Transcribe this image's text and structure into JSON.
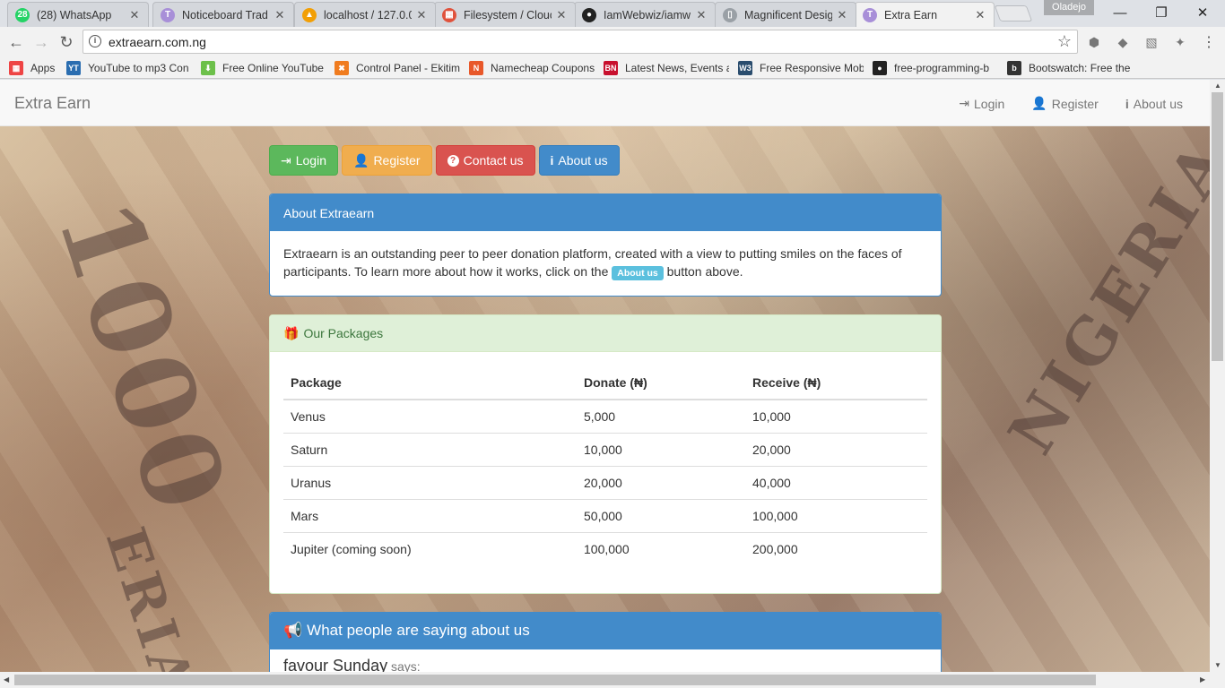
{
  "browser": {
    "tabs": [
      {
        "title": "(28) WhatsApp",
        "favicon": "whatsapp-icon",
        "color": "#25d366",
        "glyph": "28",
        "active": false
      },
      {
        "title": "Noticeboard Trad",
        "favicon": "t-letter-icon",
        "color": "#a88fd8",
        "glyph": "T",
        "active": false
      },
      {
        "title": "localhost / 127.0.0",
        "favicon": "phpmyadmin-icon",
        "color": "#f29f05",
        "glyph": "▲",
        "active": false
      },
      {
        "title": "Filesystem / Clouc",
        "favicon": "cloud9-icon",
        "color": "#e0523c",
        "glyph": "▦",
        "active": false
      },
      {
        "title": "IamWebwiz/iamw",
        "favicon": "github-icon",
        "color": "#222222",
        "glyph": "●",
        "active": false
      },
      {
        "title": "Magnificent Desig",
        "favicon": "document-icon",
        "color": "#9aa0a6",
        "glyph": "▯",
        "active": false
      },
      {
        "title": "Extra Earn",
        "favicon": "t-letter-icon",
        "color": "#a88fd8",
        "glyph": "T",
        "active": true
      }
    ],
    "profile_name": "Oladejo",
    "url": "extraearn.com.ng",
    "bookmarks": [
      {
        "label": "Apps",
        "icon": "apps-grid-icon",
        "color": "#e44",
        "glyph": "▦"
      },
      {
        "label": "YouTube to mp3 Con",
        "icon": "ytmp3-icon",
        "color": "#2a6db0",
        "glyph": "YT"
      },
      {
        "label": "Free Online YouTube",
        "icon": "download-arrow-icon",
        "color": "#6cc04a",
        "glyph": "⬇"
      },
      {
        "label": "Control Panel - Ekitim",
        "icon": "cpanel-icon",
        "color": "#f07c1f",
        "glyph": "✖"
      },
      {
        "label": "Namecheap Coupons",
        "icon": "namecheap-icon",
        "color": "#e8582a",
        "glyph": "N"
      },
      {
        "label": "Latest News, Events a",
        "icon": "bn-icon",
        "color": "#c8102e",
        "glyph": "BN"
      },
      {
        "label": "Free Responsive Mob",
        "icon": "w3schools-icon",
        "color": "#2a4d6e",
        "glyph": "W3"
      },
      {
        "label": "free-programming-b",
        "icon": "github-icon",
        "color": "#222222",
        "glyph": "●"
      },
      {
        "label": "Bootswatch: Free the",
        "icon": "bootswatch-icon",
        "color": "#333333",
        "glyph": "b"
      }
    ]
  },
  "site": {
    "brand": "Extra Earn",
    "nav": {
      "login": "Login",
      "register": "Register",
      "about": "About us"
    },
    "buttons": {
      "login": "Login",
      "register": "Register",
      "contact": "Contact us",
      "about": "About us"
    },
    "about_panel": {
      "heading": "About Extraearn",
      "text_before": "Extraearn is an outstanding peer to peer donation platform, created with a view to putting smiles on the faces of participants. To learn more about how it works, click on the",
      "badge": "About us",
      "text_after": "button above."
    },
    "packages_panel": {
      "heading": "Our Packages",
      "columns": [
        "Package",
        "Donate (₦)",
        "Receive (₦)"
      ],
      "rows": [
        [
          "Venus",
          "5,000",
          "10,000"
        ],
        [
          "Saturn",
          "10,000",
          "20,000"
        ],
        [
          "Uranus",
          "20,000",
          "40,000"
        ],
        [
          "Mars",
          "50,000",
          "100,000"
        ],
        [
          "Jupiter (coming soon)",
          "100,000",
          "200,000"
        ]
      ]
    },
    "testimonials_panel": {
      "heading": "What people are saying about us",
      "name": "favour Sunday",
      "says": "says:"
    }
  },
  "colors": {
    "success": "#5cb85c",
    "warning": "#f0ad4e",
    "danger": "#d9534f",
    "primary": "#428bca",
    "info": "#5bc0de"
  }
}
